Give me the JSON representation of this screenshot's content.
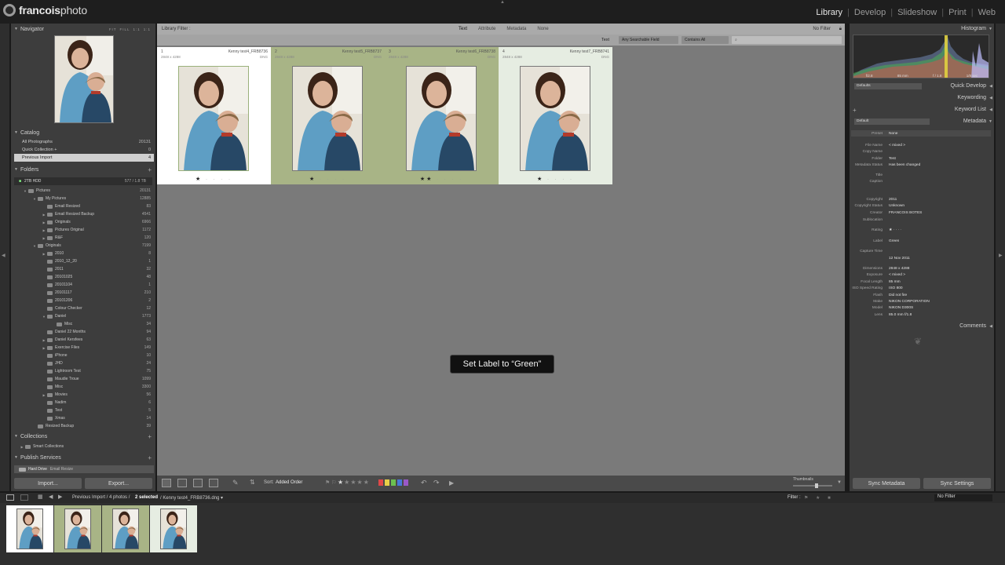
{
  "brand": {
    "logo_bold": "francois",
    "logo_rest": "photo"
  },
  "modules": [
    "Library",
    "Develop",
    "Slideshow",
    "Print",
    "Web"
  ],
  "active_module": "Library",
  "left": {
    "navigator": "Navigator",
    "nav_zoom": [
      "FIT",
      "FILL",
      "1:1",
      "1:1"
    ],
    "catalog": "Catalog",
    "catalog_items": [
      {
        "label": "All Photographs",
        "count": "20131"
      },
      {
        "label": "Quick Collection +",
        "count": "0"
      },
      {
        "label": "Previous Import",
        "count": "4"
      }
    ],
    "folders": "Folders",
    "drive": {
      "label": "2TB HDD",
      "count": "577 / 1.8 TB"
    },
    "folder_items": [
      {
        "label": "Pictures",
        "count": "20131",
        "depth": 1
      },
      {
        "label": "My Pictures",
        "count": "12885",
        "depth": 2
      },
      {
        "label": "Email Resized",
        "count": "83",
        "depth": 3
      },
      {
        "label": "Email Resized Backup",
        "count": "4541",
        "depth": 3
      },
      {
        "label": "Originals",
        "count": "6966",
        "depth": 3
      },
      {
        "label": "Pictures Original",
        "count": "1172",
        "depth": 3
      },
      {
        "label": "R&F",
        "count": "120",
        "depth": 3
      },
      {
        "label": "Originals",
        "count": "7199",
        "depth": 2
      },
      {
        "label": "2010",
        "count": "8",
        "depth": 3
      },
      {
        "label": "2010_12_20",
        "count": "1",
        "depth": 3
      },
      {
        "label": "2011",
        "count": "32",
        "depth": 3
      },
      {
        "label": "20101025",
        "count": "48",
        "depth": 3
      },
      {
        "label": "20101104",
        "count": "1",
        "depth": 3
      },
      {
        "label": "20101117",
        "count": "210",
        "depth": 3
      },
      {
        "label": "20101206",
        "count": "2",
        "depth": 3
      },
      {
        "label": "Colour Checker",
        "count": "12",
        "depth": 3
      },
      {
        "label": "Daniel",
        "count": "1773",
        "depth": 3
      },
      {
        "label": "Misc",
        "count": "34",
        "depth": 4
      },
      {
        "label": "Daniel 22 Months",
        "count": "94",
        "depth": 3
      },
      {
        "label": "Daniel Kersfees",
        "count": "63",
        "depth": 3
      },
      {
        "label": "Exercise Files",
        "count": "149",
        "depth": 3
      },
      {
        "label": "iPhone",
        "count": "10",
        "depth": 3
      },
      {
        "label": "JHD",
        "count": "24",
        "depth": 3
      },
      {
        "label": "Lightroom Test",
        "count": "75",
        "depth": 3
      },
      {
        "label": "Maudie Troue",
        "count": "1099",
        "depth": 3
      },
      {
        "label": "Misc",
        "count": "3300",
        "depth": 3
      },
      {
        "label": "Movies",
        "count": "56",
        "depth": 3
      },
      {
        "label": "Nadim",
        "count": "6",
        "depth": 3
      },
      {
        "label": "Test",
        "count": "5",
        "depth": 3
      },
      {
        "label": "Xmas",
        "count": "14",
        "depth": 3
      },
      {
        "label": "Resized Backup",
        "count": "39",
        "depth": 2
      }
    ],
    "collections": "Collections",
    "smart_collections": "Smart Collections",
    "publish": "Publish Services",
    "hard_drive": "Hard Drive",
    "hard_drive_sub": "Email Resize",
    "import_btn": "Import...",
    "export_btn": "Export..."
  },
  "filter": {
    "label": "Library Filter :",
    "options": [
      "Text",
      "Attribute",
      "Metadata",
      "None"
    ],
    "no_filter": "No Filter",
    "text_label": "Text",
    "field_select": "Any Searchable Field",
    "rule_select": "Contains All"
  },
  "grid": [
    {
      "num": "1",
      "name": "Kenny test4_FRB8736",
      "dim": "2848 x 4288",
      "ext": "DNG",
      "stars": "★",
      "bg": "#ffffff"
    },
    {
      "num": "2",
      "name": "Kenny test5_FRB8737",
      "dim": "2848 x 4288",
      "ext": "DNG",
      "stars": "★",
      "bg": "#a8b486"
    },
    {
      "num": "3",
      "name": "Kenny test6_FRB8738",
      "dim": "2848 x 4288",
      "ext": "DNG",
      "stars": "★★",
      "bg": "#a8b486"
    },
    {
      "num": "4",
      "name": "Kenny test7_FRB8741",
      "dim": "2848 x 4288",
      "ext": "DNG",
      "stars": "★",
      "bg": "#e6ede2"
    }
  ],
  "toast": "Set Label to “Green”",
  "toolbar": {
    "sort_label": "Sort:",
    "sort_value": "Added Order",
    "thumbnails": "Thumbnails"
  },
  "right": {
    "histogram": "Histogram",
    "histo_info": [
      "f/2.8",
      "85 mm",
      "f / 1.8",
      "1/8 sec"
    ],
    "defaults": "Defaults",
    "quick_develop": "Quick Develop",
    "keywording": "Keywording",
    "keyword_list": "Keyword List",
    "default": "Default",
    "metadata": "Metadata",
    "preset_label": "Preset",
    "preset_value": "None",
    "meta_rows": [
      {
        "k": "File Name",
        "v": "< mixed >"
      },
      {
        "k": "Copy Name",
        "v": ""
      },
      {
        "k": "Folder",
        "v": "Test"
      },
      {
        "k": "Metadata Status",
        "v": "Has been changed"
      },
      {
        "k": "Title",
        "v": ""
      },
      {
        "k": "Caption",
        "v": ""
      },
      {
        "k": "Copyright",
        "v": "2011"
      },
      {
        "k": "Copyright Status",
        "v": "Unknown"
      },
      {
        "k": "Creator",
        "v": "FRANCOIS BOTES"
      },
      {
        "k": "Sublocation",
        "v": ""
      },
      {
        "k": "Rating",
        "v": "★ · · · ·"
      },
      {
        "k": "Label",
        "v": "Green"
      },
      {
        "k": "Capture Time",
        "v": ""
      },
      {
        "k": "",
        "v": "12 Nov 2011"
      },
      {
        "k": "Dimensions",
        "v": "2848 x 4288"
      },
      {
        "k": "Exposure",
        "v": "< mixed >"
      },
      {
        "k": "Focal Length",
        "v": "85 mm"
      },
      {
        "k": "ISO Speed Rating",
        "v": "ISO 800"
      },
      {
        "k": "Flash",
        "v": "Did not fire"
      },
      {
        "k": "Make",
        "v": "NIKON CORPORATION"
      },
      {
        "k": "Model",
        "v": "NIKON D300S"
      },
      {
        "k": "Lens",
        "v": "85.0 mm f/1.8"
      }
    ],
    "comments": "Comments",
    "sync_metadata": "Sync Metadata",
    "sync_settings": "Sync Settings"
  },
  "filmbar": {
    "path": "Previous Import / 4 photos /",
    "selected": "2 selected",
    "file": "/ Kenny test4_FRB8736.dng ▾",
    "filter_label": "Filter :",
    "filter_value": "No Filter"
  },
  "colors": {
    "green_label": "#a8b486",
    "panel": "#3d3d3d",
    "center": "#7a7a7a"
  }
}
